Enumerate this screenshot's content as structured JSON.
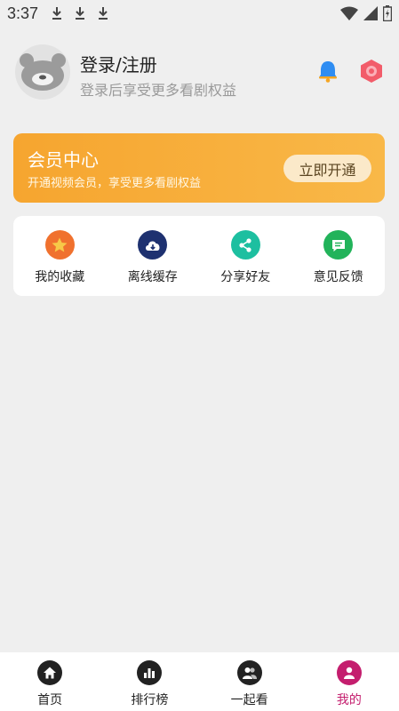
{
  "status_bar": {
    "time": "3:37"
  },
  "header": {
    "title": "登录/注册",
    "subtitle": "登录后享受更多看剧权益"
  },
  "vip_card": {
    "title": "会员中心",
    "subtitle": "开通视频会员，享受更多看剧权益",
    "button": "立即开通"
  },
  "shortcuts": [
    {
      "label": "我的收藏",
      "icon": "star-icon",
      "color": "#f0712e"
    },
    {
      "label": "离线缓存",
      "icon": "download-cloud-icon",
      "color": "#1e3170"
    },
    {
      "label": "分享好友",
      "icon": "share-icon",
      "color": "#1dbfa0"
    },
    {
      "label": "意见反馈",
      "icon": "feedback-icon",
      "color": "#22b35a"
    }
  ],
  "bottom_nav": [
    {
      "label": "首页",
      "icon": "home-icon"
    },
    {
      "label": "排行榜",
      "icon": "rank-icon"
    },
    {
      "label": "一起看",
      "icon": "watch-together-icon"
    },
    {
      "label": "我的",
      "icon": "profile-icon",
      "active": true
    }
  ],
  "colors": {
    "accent": "#c41e6e",
    "vip_start": "#f6a52f",
    "vip_end": "#f9b848",
    "background": "#efefef"
  }
}
